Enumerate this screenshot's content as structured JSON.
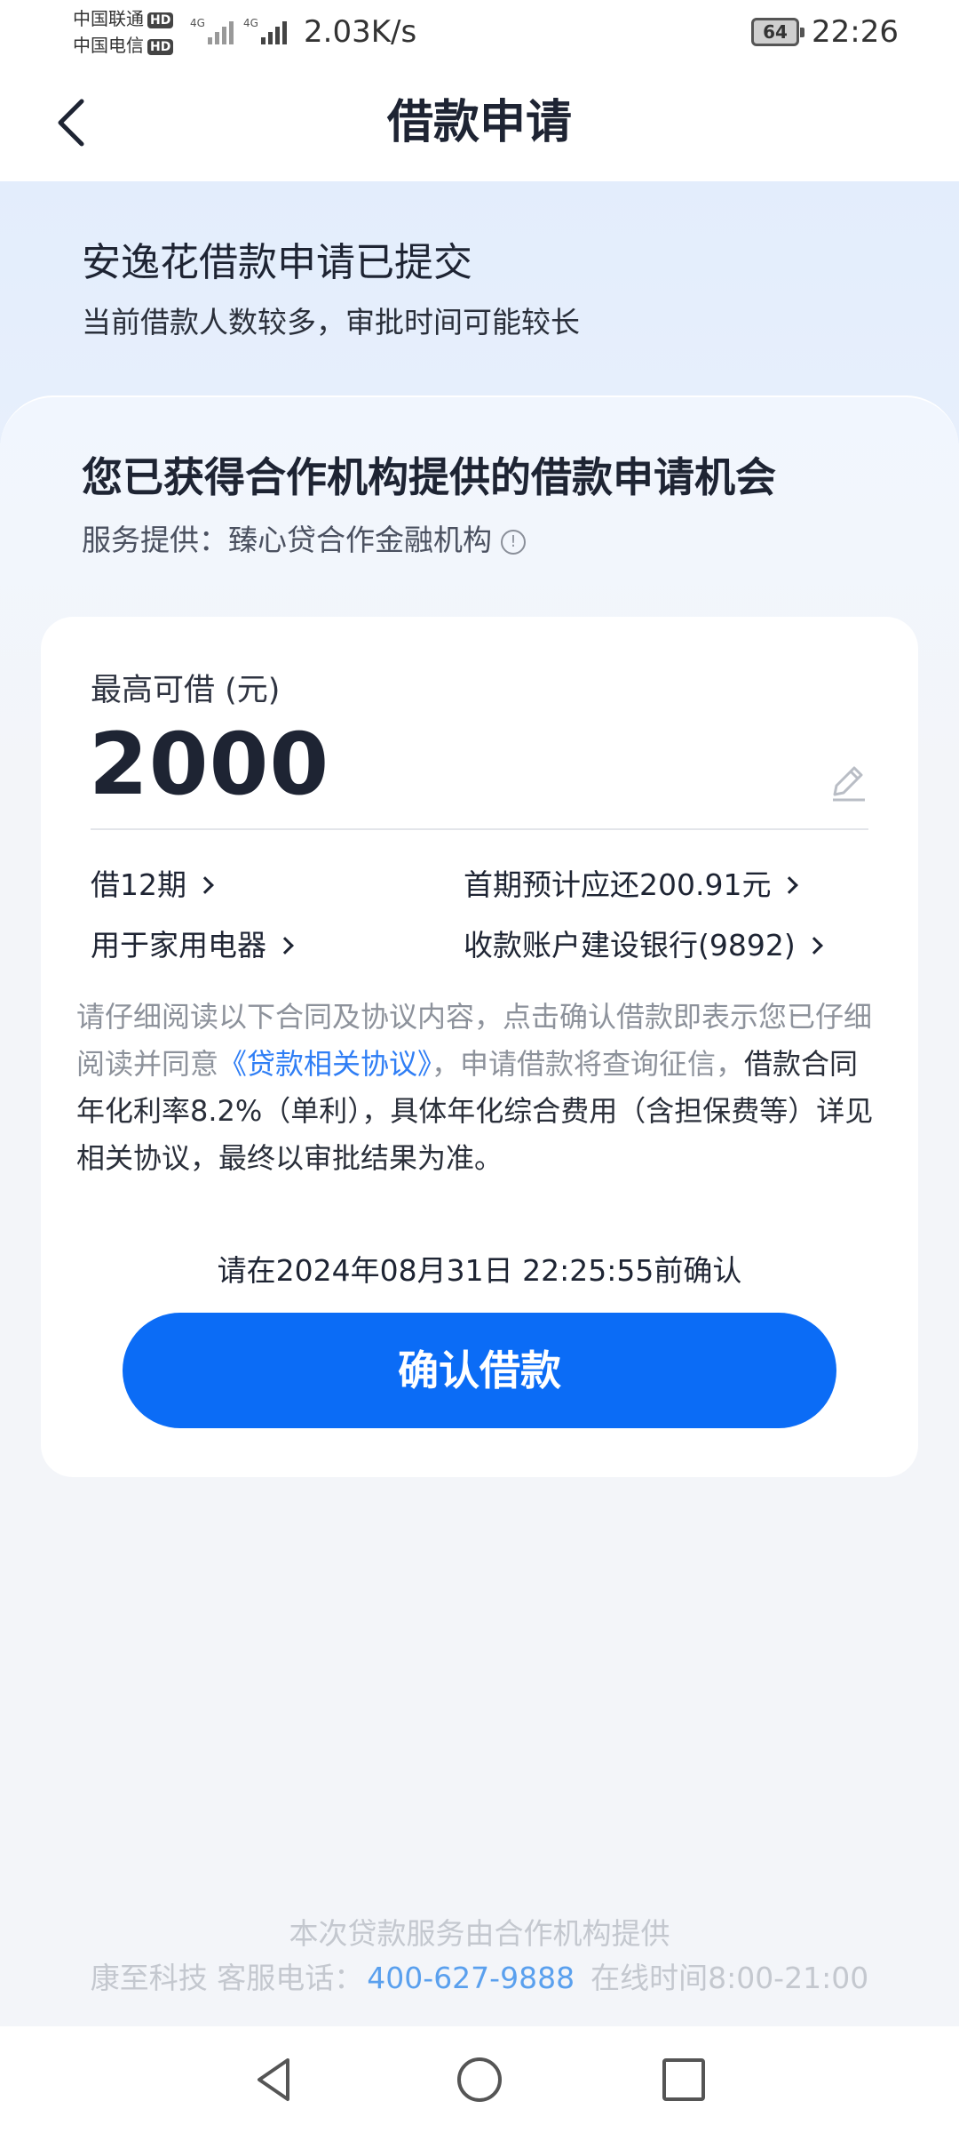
{
  "status_bar": {
    "carrier1": "中国联通",
    "carrier2": "中国电信",
    "hd": "HD",
    "network_type": "4G",
    "net_speed": "2.03K/s",
    "battery": "64",
    "time": "22:26"
  },
  "nav": {
    "title": "借款申请"
  },
  "status": {
    "title": "安逸花借款申请已提交",
    "desc": "当前借款人数较多，审批时间可能较长"
  },
  "offer": {
    "title": "您已获得合作机构提供的借款申请机会",
    "provider_label": "服务提供：",
    "provider_name": "臻心贷合作金融机构"
  },
  "loan": {
    "max_label": "最高可借 (元)",
    "amount": "2000",
    "term": "借12期",
    "first_payment": "首期预计应还200.91元",
    "purpose": "用于家用电器",
    "account": "收款账户建设银行(9892)"
  },
  "notice": {
    "part1": "请仔细阅读以下合同及协议内容，点击确认借款即表示您已仔细阅读并同意",
    "link": "《贷款相关协议》",
    "part2": "，申请借款将查询征信，",
    "part3": "借款合同年化利率8.2%（单利），具体年化综合费用（含担保费等）详见相关协议，最终以审批结果为准。"
  },
  "confirm": {
    "deadline": "请在2024年08月31日 22:25:55前确认",
    "button": "确认借款"
  },
  "footer": {
    "line1": "本次贷款服务由合作机构提供",
    "company": "康至科技 客服电话：",
    "phone": "400-627-9888",
    "hours": "在线时间8:00-21:00"
  },
  "colors": {
    "primary": "#0b6cf6",
    "link": "#2f7ef5",
    "title": "#1e2433",
    "muted": "#8d929b"
  }
}
